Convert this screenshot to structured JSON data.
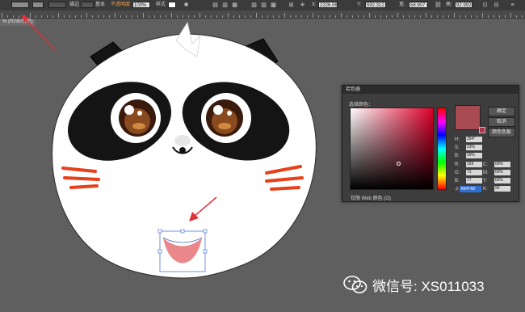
{
  "toolbar": {
    "items": [
      {
        "label": "描边",
        "kind": "text"
      },
      {
        "label": "基本",
        "kind": "text"
      },
      {
        "label": "不透明度",
        "kind": "text"
      },
      {
        "label": "100%",
        "kind": "box"
      },
      {
        "label": "样式",
        "kind": "text"
      },
      {
        "label": "X:",
        "kind": "text"
      },
      {
        "label": "2226.064",
        "kind": "box"
      },
      {
        "label": "Y:",
        "kind": "text"
      },
      {
        "label": "592.312",
        "kind": "box"
      },
      {
        "label": "宽:",
        "kind": "text"
      },
      {
        "label": "58.907 mm",
        "kind": "box"
      },
      {
        "label": "高:",
        "kind": "text"
      },
      {
        "label": "92.992 mm",
        "kind": "box"
      }
    ]
  },
  "doc_tab": {
    "label": "% (RGB/预览)"
  },
  "color_picker": {
    "title": "拾色器",
    "select_label": "选择颜色：",
    "ok": "确定",
    "cancel": "取消",
    "swatches": "颜色色板",
    "current_color": "#a84a52",
    "hsb": [
      {
        "label": "H:",
        "value": "354°"
      },
      {
        "label": "S:",
        "value": "53%"
      },
      {
        "label": "B:",
        "value": "59%"
      }
    ],
    "rgb": [
      {
        "label": "R:",
        "value": "169"
      },
      {
        "label": "G:",
        "value": "71"
      },
      {
        "label": "B:",
        "value": "77"
      }
    ],
    "cmyk": [
      {
        "label": "C:",
        "value": "69%"
      },
      {
        "label": "M:",
        "value": "69%"
      },
      {
        "label": "Y:",
        "value": "69%"
      },
      {
        "label": "K:",
        "value": "90"
      }
    ],
    "hex_label": "#",
    "hex_value": "A9474D",
    "web_only_label": "仅限 Web 颜色 (O)"
  },
  "watermark": {
    "text": "微信号: XS011033"
  },
  "colors": {
    "mouth_fill": "#e9878b",
    "cheek": "#e8401a",
    "arrow": "#e0303a"
  }
}
